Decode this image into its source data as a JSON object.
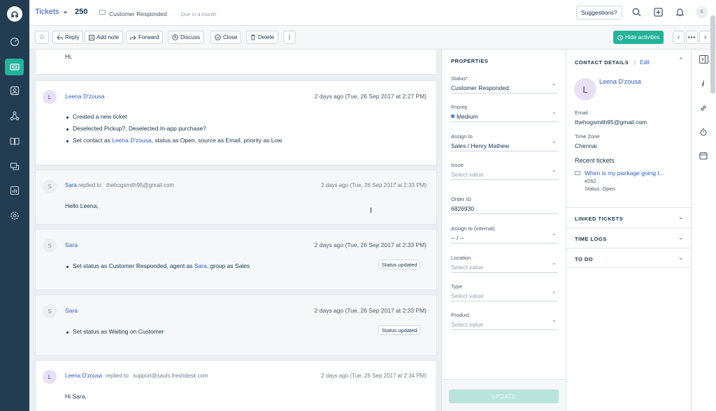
{
  "header": {
    "breadcrumb_root": "Tickets",
    "ticket_number": "250",
    "status_text": "Customer Responded",
    "due_text": "· Due in a month",
    "suggestions_label": "Suggestions?",
    "user_initial": "S"
  },
  "toolbar": {
    "reply": "Reply",
    "add_note": "Add note",
    "forward": "Forward",
    "discuss": "Discuss",
    "close": "Close",
    "delete": "Delete",
    "more": "⋮",
    "hide_activities": "Hide activities"
  },
  "feed": {
    "top_greeting": "Hi,",
    "activity1": {
      "initial": "L",
      "name": "Leena D'zousa",
      "time": "2 days ago (Tue, 26 Sep 2017 at 2:27 PM)",
      "items": [
        "Created a new ticket",
        "Deselected Pickup?, Deselected In-app purchase?"
      ],
      "item3_pre": "Set contact as ",
      "item3_link": "Leena D'zousa",
      "item3_post": ", status as Open, source as Email, priority as Low"
    },
    "reply1": {
      "initial": "S",
      "name": "Sara",
      "replied_to": "replied to",
      "email": "thehogsmith95@gmail.com",
      "time": "2 days ago (Tue, 26 Sep 2017 at 2:33 PM)",
      "body": "Hello Leena,"
    },
    "activity2": {
      "initial": "S",
      "name": "Sara",
      "time": "2 days ago (Tue, 26 Sep 2017 at 2:33 PM)",
      "text_pre": "Set status as Customer Responded, agent as ",
      "text_link": "Sara",
      "text_post": ", group as Sales",
      "badge": "Status updated"
    },
    "activity3": {
      "initial": "S",
      "name": "Sara",
      "time": "2 days ago (Tue, 26 Sep 2017 at 2:33 PM)",
      "text": "Set status as Waiting on Customer",
      "badge": "Status updated"
    },
    "reply2": {
      "initial": "L",
      "name": "Leena D'zousa",
      "replied_to": "replied to",
      "email": "support@sauls.freshdesk.com",
      "time": "2 days ago (Tue, 26 Sep 2017 at 2:34 PM)",
      "body": "Hi Sara,"
    }
  },
  "properties": {
    "title": "PROPERTIES",
    "status_label": "Status",
    "required_mark": "*",
    "status_value": "Customer Responded",
    "priority_label": "Priority",
    "priority_value": "Medium",
    "priority_color": "#4d8bd8",
    "assign_label": "Assign to",
    "assign_value": "Sales / Henry Mathew",
    "issue_label": "Issue",
    "issue_placeholder": "Select value",
    "order_label": "Order ID",
    "order_value": "6826930",
    "assign_internal_label": "Assign to (internal)",
    "assign_internal_value": "-- / --",
    "location_label": "Location",
    "location_placeholder": "Select value",
    "type_label": "Type",
    "type_placeholder": "Select value",
    "product_label": "Product",
    "product_placeholder": "Select value",
    "update_button": "UPDATE"
  },
  "contact": {
    "title": "CONTACT DETAILS",
    "separator": "|",
    "edit": "Edit",
    "initial": "L",
    "name": "Leena D'zousa",
    "email_label": "Email",
    "email_value": "thehogsmith95@gmail.com",
    "timezone_label": "Time Zone",
    "timezone_value": "Chennai",
    "recent_label": "Recent tickets",
    "recent_title": "When is my package going t...",
    "recent_number": "#262",
    "recent_status": "Status: Open",
    "linked_tickets": "LINKED TICKETS",
    "time_logs": "TIME LOGS",
    "to_do": "TO DO"
  },
  "colors": {
    "sidebar": "#223d52",
    "accent": "#23b39a",
    "link": "#2c5cc5"
  }
}
